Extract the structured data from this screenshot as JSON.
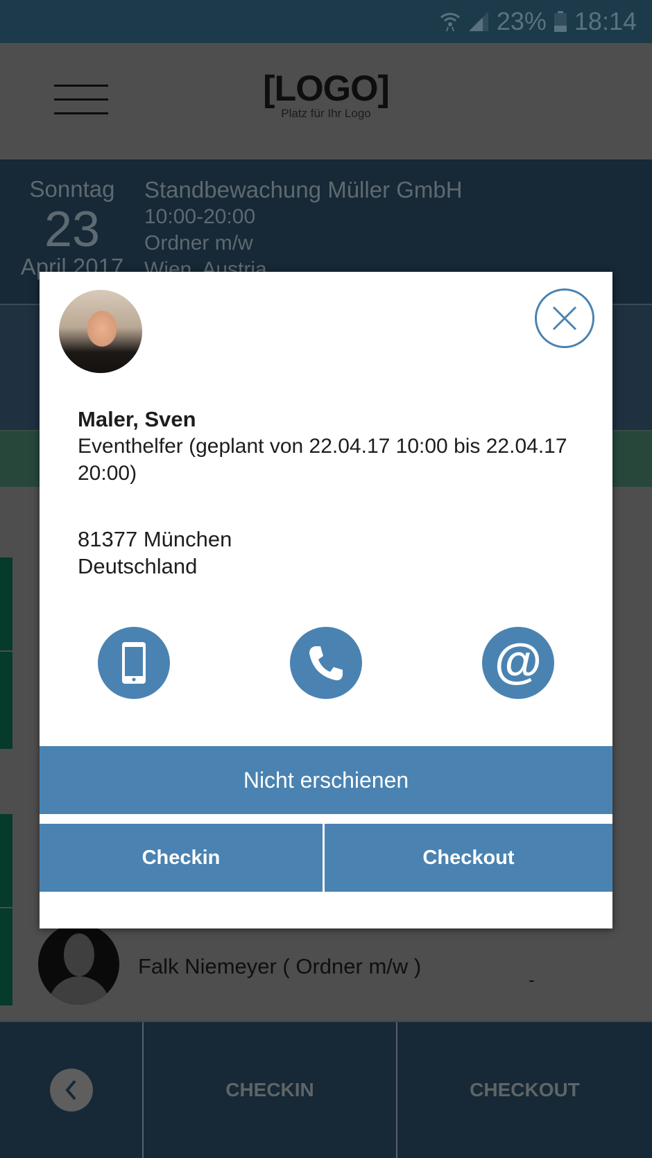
{
  "status_bar": {
    "battery": "23%",
    "time": "18:14",
    "icons": [
      "wifi-icon",
      "signal-icon",
      "battery-icon"
    ]
  },
  "app_bar": {
    "menu_icon": "hamburger-icon",
    "logo_main": "[LOGO]",
    "logo_sub": "Platz für Ihr Logo"
  },
  "event": {
    "weekday": "Sonntag",
    "day": "23",
    "month_year": "April 2017",
    "company": "Standbewachung Müller GmbH",
    "time_range": "10:00-20:00",
    "role": "Ordner m/w",
    "location": "Wien, Austria"
  },
  "list": {
    "visible_row": {
      "name": "Falk Niemeyer ( Ordner m/w )",
      "status": "-"
    }
  },
  "bottom_nav": {
    "back_icon": "chevron-left-icon",
    "checkin_label": "CHECKIN",
    "checkout_label": "CHECKOUT"
  },
  "modal": {
    "close_icon": "close-icon",
    "name": "Maler, Sven",
    "role_line": "Eventhelfer (geplant von 22.04.17 10:00 bis 22.04.17 20:00)",
    "address_line1": "81377 München",
    "address_line2": "Deutschland",
    "contact_icons": [
      "mobile-phone-icon",
      "phone-icon",
      "email-at-icon"
    ],
    "at_symbol": "@",
    "no_show_label": "Nicht erschienen",
    "checkin_label": "Checkin",
    "checkout_label": "Checkout",
    "accent_color": "#4a83b1"
  }
}
